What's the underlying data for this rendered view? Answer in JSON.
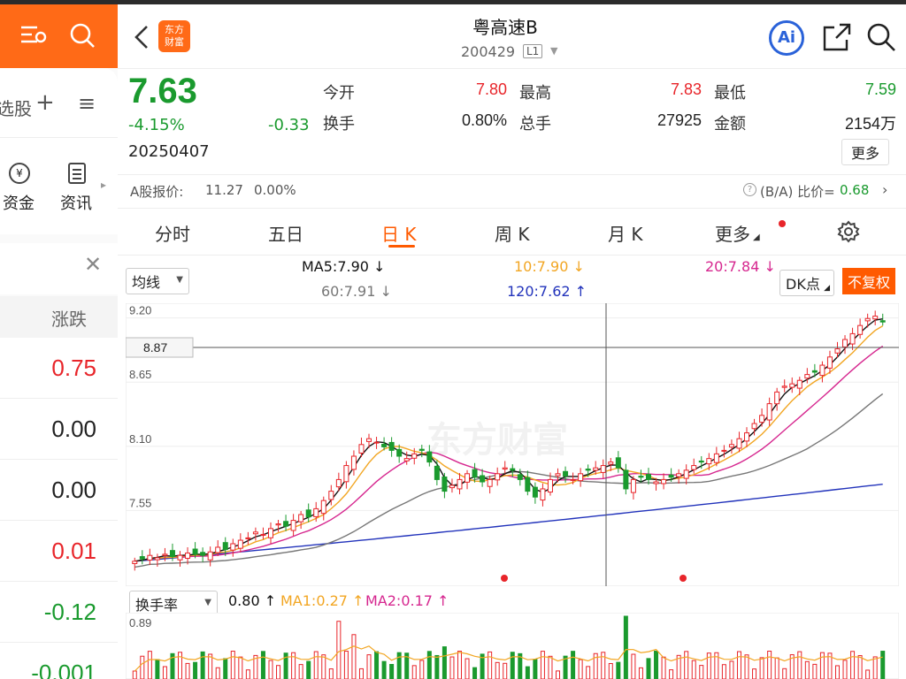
{
  "left_panel": {
    "tab_partial": "选股",
    "funds_label": "资金",
    "news_label": "资讯",
    "column_header": "涨跌",
    "values": [
      {
        "text": "0.75",
        "tone": "red"
      },
      {
        "text": "0.00",
        "tone": "dark"
      },
      {
        "text": "0.00",
        "tone": "dark"
      },
      {
        "text": "0.01",
        "tone": "red"
      },
      {
        "text": "-0.12",
        "tone": "green"
      },
      {
        "text": "-0.001",
        "tone": "green"
      }
    ]
  },
  "header": {
    "title": "粤高速B",
    "code": "200429",
    "level_badge": "L1",
    "logo_text_top": "东方",
    "logo_text_bottom": "财富",
    "ai_label": "Ai"
  },
  "quote": {
    "price": "7.63",
    "change_pct": "-4.15%",
    "change": "-0.33",
    "date": "20250407",
    "open_label": "今开",
    "open": "7.80",
    "high_label": "最高",
    "high": "7.83",
    "low_label": "最低",
    "low": "7.59",
    "turnover_label": "换手",
    "turnover": "0.80%",
    "volume_label": "总手",
    "volume": "27925",
    "amount_label": "金额",
    "amount": "2154万",
    "more_label": "更多"
  },
  "a_share": {
    "label": "A股报价:",
    "price": "11.27",
    "pct": "0.00%",
    "ratio_label": "(B/A) 比价=",
    "ratio": "0.68"
  },
  "tabs": [
    {
      "label": "分时",
      "active": false
    },
    {
      "label": "五日",
      "active": false
    },
    {
      "label": "日 K",
      "active": true
    },
    {
      "label": "周 K",
      "active": false
    },
    {
      "label": "月 K",
      "active": false
    },
    {
      "label": "更多",
      "active": false
    }
  ],
  "indicators": {
    "ma_select": "均线",
    "ma5": "MA5:7.90",
    "ma10": "10:7.90",
    "ma20": "20:7.84",
    "ma60": "60:7.91",
    "ma120": "120:7.62",
    "dk_label": "DK点",
    "fq_label": "不复权",
    "vol_select": "换手率",
    "vol_value": "0.80",
    "vol_ma1": "MA1:0.27",
    "vol_ma2": "MA2:0.17",
    "vol_top_label": "0.89"
  },
  "colors": {
    "accent": "#ff6a17",
    "up": "#e8252a",
    "down": "#1a9a2e",
    "ma5": "#111111",
    "ma10": "#f2a623",
    "ma20": "#d6278f",
    "ma60": "#777777",
    "ma120": "#2233bb"
  },
  "chart_data": {
    "type": "candlestick",
    "y_ticks": [
      "9.20",
      "8.65",
      "8.10",
      "7.55"
    ],
    "crosshair_price": "8.87",
    "watermark": "东方财富",
    "ylim": [
      7.0,
      9.25
    ],
    "close": [
      7.1,
      7.12,
      7.15,
      7.13,
      7.16,
      7.14,
      7.15,
      7.17,
      7.16,
      7.15,
      7.18,
      7.22,
      7.2,
      7.25,
      7.28,
      7.3,
      7.35,
      7.33,
      7.38,
      7.42,
      7.4,
      7.45,
      7.5,
      7.48,
      7.55,
      7.62,
      7.7,
      7.8,
      7.92,
      8.0,
      8.1,
      8.15,
      8.12,
      8.08,
      8.05,
      8.0,
      7.98,
      8.02,
      8.05,
      7.95,
      7.8,
      7.7,
      7.75,
      7.8,
      7.85,
      7.82,
      7.78,
      7.8,
      7.85,
      7.9,
      7.88,
      7.8,
      7.7,
      7.65,
      7.72,
      7.8,
      7.85,
      7.83,
      7.8,
      7.85,
      7.88,
      7.9,
      7.92,
      7.95,
      7.9,
      7.72,
      7.8,
      7.82,
      7.8,
      7.78,
      7.8,
      7.82,
      7.85,
      7.88,
      7.92,
      7.95,
      7.98,
      8.02,
      8.05,
      8.1,
      8.15,
      8.2,
      8.28,
      8.35,
      8.45,
      8.55,
      8.6,
      8.62,
      8.65,
      8.7,
      8.72,
      8.78,
      8.85,
      8.92,
      9.0,
      9.05,
      9.12,
      9.18,
      9.2,
      9.15
    ],
    "ma120_values": [
      7.1,
      7.61
    ],
    "volume_ma_labels": [
      "MA1",
      "MA2"
    ]
  }
}
